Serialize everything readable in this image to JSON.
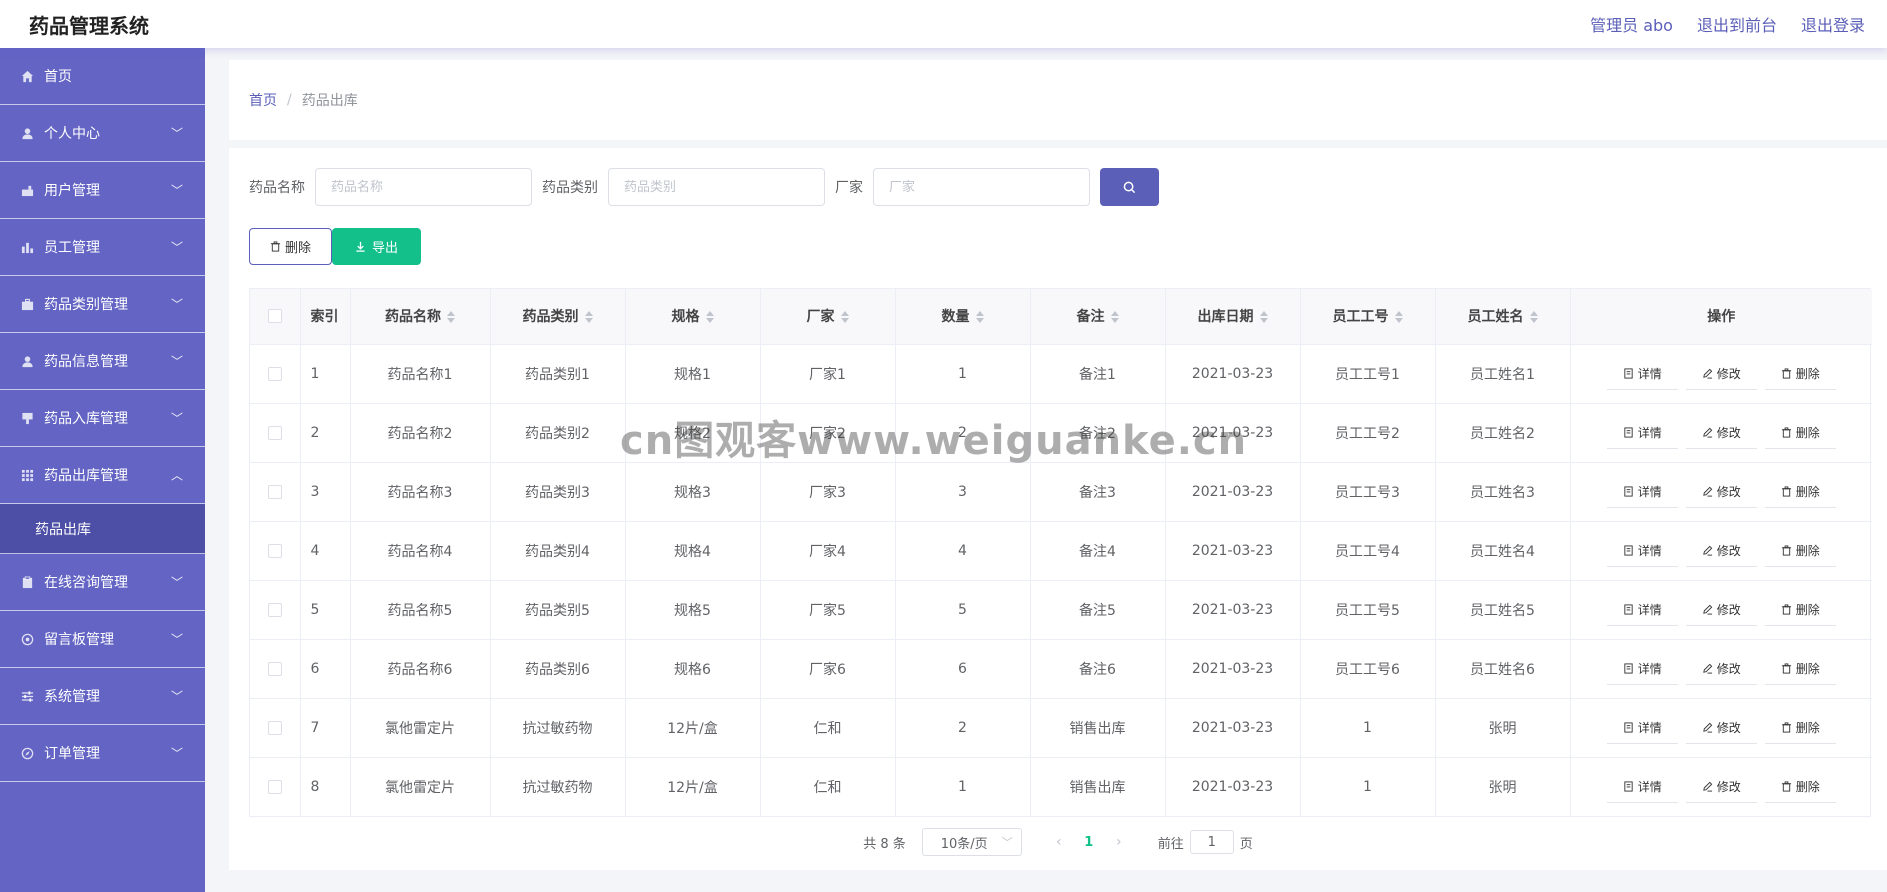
{
  "header": {
    "title": "药品管理系统",
    "admin_link": "管理员 abo",
    "frontend_link": "退出到前台",
    "logout_link": "退出登录"
  },
  "sidebar": {
    "items": [
      {
        "label": "首页",
        "icon": "home-icon"
      },
      {
        "label": "个人中心",
        "icon": "user-icon"
      },
      {
        "label": "用户管理",
        "icon": "chart-icon"
      },
      {
        "label": "员工管理",
        "icon": "bar-chart-icon"
      },
      {
        "label": "药品类别管理",
        "icon": "briefcase-icon"
      },
      {
        "label": "药品信息管理",
        "icon": "user-icon"
      },
      {
        "label": "药品入库管理",
        "icon": "stamp-icon"
      },
      {
        "label": "药品出库管理",
        "icon": "grid-icon"
      },
      {
        "label": "在线咨询管理",
        "icon": "clipboard-icon"
      },
      {
        "label": "留言板管理",
        "icon": "globe-icon"
      },
      {
        "label": "系统管理",
        "icon": "sliders-icon"
      },
      {
        "label": "订单管理",
        "icon": "compass-icon"
      }
    ],
    "submenu_label": "药品出库"
  },
  "breadcrumb": {
    "home": "首页",
    "separator": "/",
    "current": "药品出库"
  },
  "search": {
    "name_label": "药品名称",
    "name_placeholder": "药品名称",
    "category_label": "药品类别",
    "category_placeholder": "药品类别",
    "maker_label": "厂家",
    "maker_placeholder": "厂家"
  },
  "actions": {
    "delete_label": "删除",
    "export_label": "导出"
  },
  "table": {
    "headers": [
      "索引",
      "药品名称",
      "药品类别",
      "规格",
      "厂家",
      "数量",
      "备注",
      "出库日期",
      "员工工号",
      "员工姓名",
      "操作"
    ],
    "rows": [
      [
        "1",
        "药品名称1",
        "药品类别1",
        "规格1",
        "厂家1",
        "1",
        "备注1",
        "2021-03-23",
        "员工工号1",
        "员工姓名1"
      ],
      [
        "2",
        "药品名称2",
        "药品类别2",
        "规格2",
        "厂家2",
        "2",
        "备注2",
        "2021-03-23",
        "员工工号2",
        "员工姓名2"
      ],
      [
        "3",
        "药品名称3",
        "药品类别3",
        "规格3",
        "厂家3",
        "3",
        "备注3",
        "2021-03-23",
        "员工工号3",
        "员工姓名3"
      ],
      [
        "4",
        "药品名称4",
        "药品类别4",
        "规格4",
        "厂家4",
        "4",
        "备注4",
        "2021-03-23",
        "员工工号4",
        "员工姓名4"
      ],
      [
        "5",
        "药品名称5",
        "药品类别5",
        "规格5",
        "厂家5",
        "5",
        "备注5",
        "2021-03-23",
        "员工工号5",
        "员工姓名5"
      ],
      [
        "6",
        "药品名称6",
        "药品类别6",
        "规格6",
        "厂家6",
        "6",
        "备注6",
        "2021-03-23",
        "员工工号6",
        "员工姓名6"
      ],
      [
        "7",
        "氯他雷定片",
        "抗过敏药物",
        "12片/盒",
        "仁和",
        "2",
        "销售出库",
        "2021-03-23",
        "1",
        "张明"
      ],
      [
        "8",
        "氯他雷定片",
        "抗过敏药物",
        "12片/盒",
        "仁和",
        "1",
        "销售出库",
        "2021-03-23",
        "1",
        "张明"
      ]
    ],
    "op_detail": "详情",
    "op_edit": "修改",
    "op_delete": "删除"
  },
  "pagination": {
    "total": "共 8 条",
    "page_size": "10条/页",
    "current_page": "1",
    "goto_label": "前往",
    "goto_value": "1",
    "page_suffix": "页"
  },
  "watermark": "cn图观客www.weiguanke.cn",
  "colors": {
    "sidebar": "#6364c4",
    "submenu": "#4d4ea6",
    "accent": "#5b5fb8",
    "success": "#13c08a"
  }
}
